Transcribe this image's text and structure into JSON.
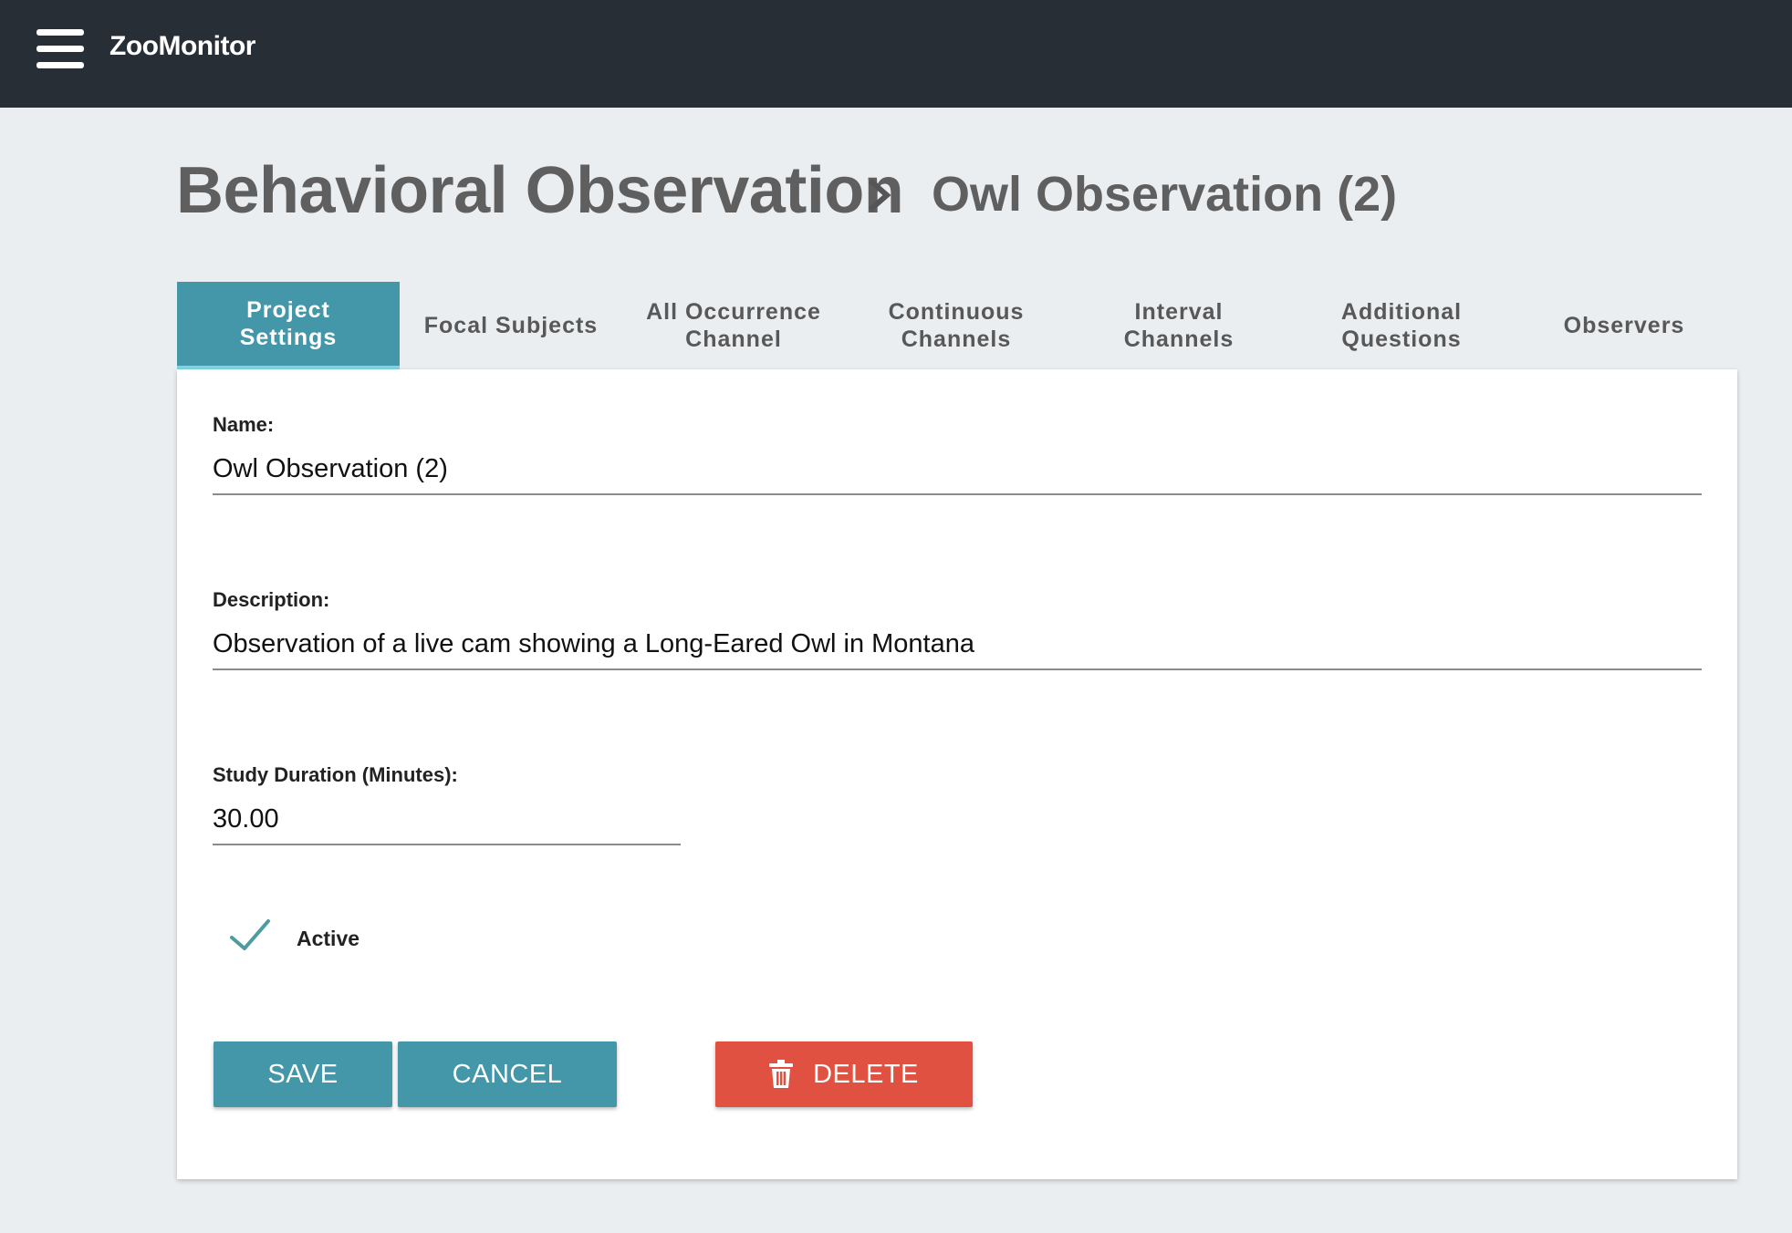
{
  "app": {
    "title": "ZooMonitor"
  },
  "breadcrumb": {
    "section": "Behavioral Observation",
    "current": "Owl Observation (2)"
  },
  "tabs": [
    {
      "label": "Project\nSettings",
      "active": true
    },
    {
      "label": "Focal Subjects",
      "active": false
    },
    {
      "label": "All Occurrence\nChannel",
      "active": false
    },
    {
      "label": "Continuous\nChannels",
      "active": false
    },
    {
      "label": "Interval\nChannels",
      "active": false
    },
    {
      "label": "Additional\nQuestions",
      "active": false
    },
    {
      "label": "Observers",
      "active": false
    }
  ],
  "form": {
    "name": {
      "label": "Name:",
      "value": "Owl Observation (2)"
    },
    "description": {
      "label": "Description:",
      "value": "Observation of a live cam showing a Long-Eared Owl in Montana"
    },
    "duration": {
      "label": "Study Duration (Minutes):",
      "value": "30.00"
    },
    "active": {
      "label": "Active",
      "checked": true
    }
  },
  "buttons": {
    "save": "SAVE",
    "cancel": "CANCEL",
    "delete": "DELETE"
  },
  "icons": {
    "menu": "hamburger-menu-icon",
    "separator": "chevron-right-icon",
    "check": "checkmark-icon",
    "delete": "trash-icon"
  },
  "colors": {
    "topbar": "#282e36",
    "accent": "#4397a8",
    "danger": "#e05141",
    "background": "#ebeef0"
  }
}
